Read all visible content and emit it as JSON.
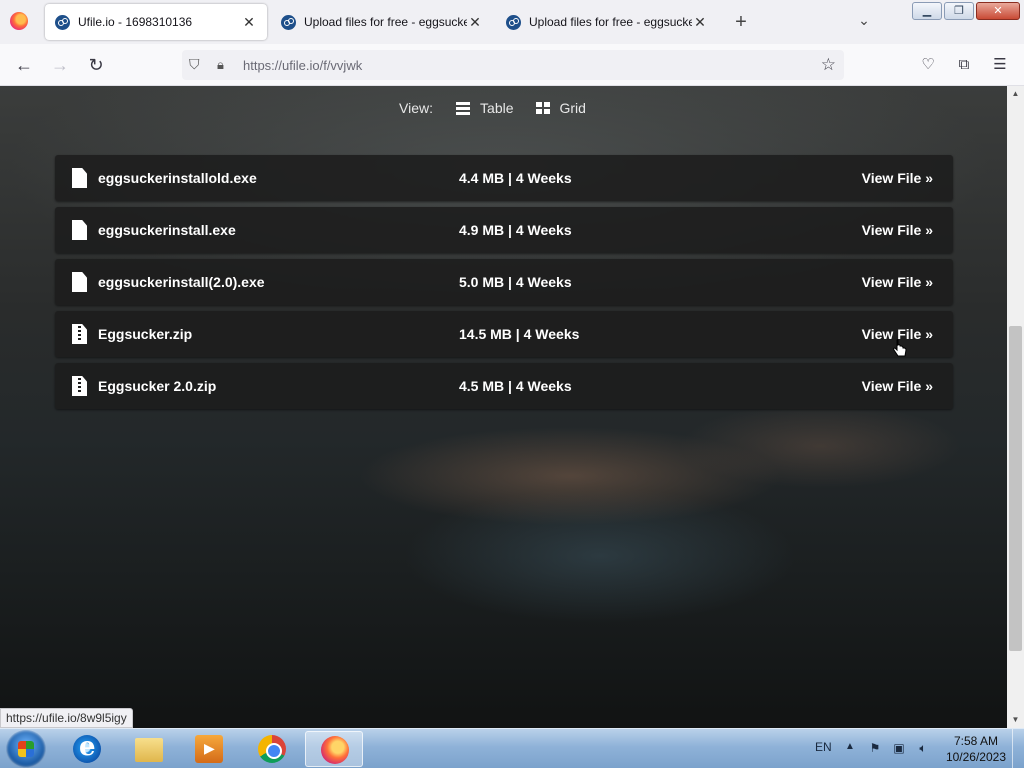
{
  "browser": {
    "tabs": [
      {
        "title": "Ufile.io - 1698310136",
        "active": true
      },
      {
        "title": "Upload files for free - eggsucker",
        "active": false
      },
      {
        "title": "Upload files for free - eggsucker",
        "active": false
      }
    ],
    "url": "https://ufile.io/f/vvjwk",
    "status_url": "https://ufile.io/8w9l5igy"
  },
  "view_switch": {
    "label": "View:",
    "options": [
      {
        "label": "Table",
        "icon": "table-icon"
      },
      {
        "label": "Grid",
        "icon": "grid-icon"
      }
    ]
  },
  "files": [
    {
      "name": "eggsuckerinstallold.exe",
      "meta": "4.4 MB | 4 Weeks",
      "link": "View File »",
      "icon": "file-icon"
    },
    {
      "name": "eggsuckerinstall.exe",
      "meta": "4.9 MB | 4 Weeks",
      "link": "View File »",
      "icon": "file-icon"
    },
    {
      "name": "eggsuckerinstall(2.0).exe",
      "meta": "5.0 MB | 4 Weeks",
      "link": "View File »",
      "icon": "file-icon"
    },
    {
      "name": "Eggsucker.zip",
      "meta": "14.5 MB | 4 Weeks",
      "link": "View File »",
      "icon": "zip-file-icon"
    },
    {
      "name": "Eggsucker 2.0.zip",
      "meta": "4.5 MB | 4 Weeks",
      "link": "View File »",
      "icon": "zip-file-icon"
    }
  ],
  "taskbar": {
    "language": "EN",
    "time": "7:58 AM",
    "date": "10/26/2023",
    "apps": [
      "internet-explorer-icon",
      "file-explorer-icon",
      "media-player-icon",
      "chrome-icon",
      "firefox-icon"
    ]
  },
  "colors": {
    "row_bg": "#1c1c1c",
    "text": "#ffffff",
    "url_text": "#6a6a75"
  }
}
